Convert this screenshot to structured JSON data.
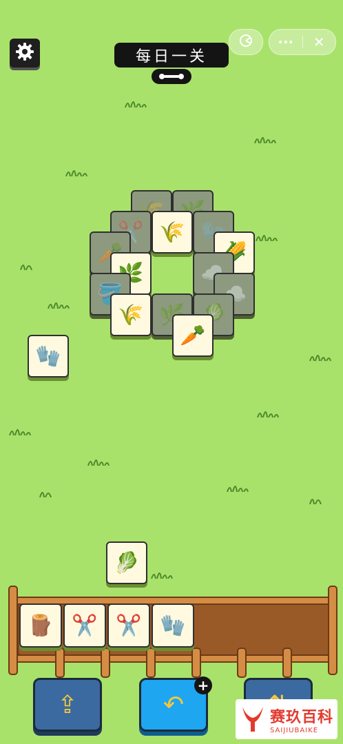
{
  "header": {
    "title": "每日一关",
    "settings_icon": "gear-icon",
    "toggle_icon": "link-toggle-icon"
  },
  "capsule": {
    "game_icon": "game-circle-icon",
    "more_label": "···",
    "close_label": "✕"
  },
  "board": {
    "tiles": [
      {
        "icon": "wheat-bundle",
        "glyph": "🌾",
        "dim": true
      },
      {
        "icon": "grass",
        "glyph": "🌿",
        "dim": true
      },
      {
        "icon": "pruning-shears",
        "glyph": "✂️",
        "dim": true
      },
      {
        "icon": "wheat-bundle",
        "glyph": "🌾",
        "dim": false
      },
      {
        "icon": "blue-glove",
        "glyph": "🧤",
        "dim": true
      },
      {
        "icon": "carrot",
        "glyph": "🥕",
        "dim": true
      },
      {
        "icon": "corn",
        "glyph": "🌽",
        "dim": false
      },
      {
        "icon": "grass",
        "glyph": "🌿",
        "dim": false
      },
      {
        "icon": "bush",
        "glyph": "☁️",
        "dim": true
      },
      {
        "icon": "watering-can",
        "glyph": "🪣",
        "dim": true
      },
      {
        "icon": "bush",
        "glyph": "☁️",
        "dim": true
      },
      {
        "icon": "wheat-bundle",
        "glyph": "🌾",
        "dim": false
      },
      {
        "icon": "grass",
        "glyph": "🌿",
        "dim": true
      },
      {
        "icon": "cabbage",
        "glyph": "🥬",
        "dim": true
      },
      {
        "icon": "carrot",
        "glyph": "🥕",
        "dim": false
      }
    ],
    "loose_tiles": [
      {
        "icon": "blue-glove",
        "glyph": "🧤"
      },
      {
        "icon": "cabbage",
        "glyph": "🥬"
      }
    ]
  },
  "tray": {
    "slots_total": 7,
    "items": [
      {
        "icon": "tree-stump",
        "glyph": "🪵"
      },
      {
        "icon": "pruning-shears",
        "glyph": "✂️"
      },
      {
        "icon": "pruning-shears",
        "glyph": "✂️"
      },
      {
        "icon": "blue-glove",
        "glyph": "🧤"
      }
    ]
  },
  "tools": [
    {
      "name": "remove-tool",
      "icon": "box-out-icon",
      "glyph": "⇪"
    },
    {
      "name": "undo-tool",
      "icon": "undo-arrow-icon",
      "glyph": "↶"
    },
    {
      "name": "shuffle-tool",
      "icon": "shuffle-icon",
      "glyph": "⇅"
    }
  ],
  "plus_label": "+",
  "watermark": {
    "title": "赛玖百科",
    "subtitle": "SAIJIUBAIKE"
  },
  "colors": {
    "background": "#a9e26a",
    "tile_face": "#fff9e0",
    "tile_dim": "#8d9a80",
    "tray_wood": "#9a5a28",
    "button_blue": "#1fa6f0",
    "button_dark_blue": "#3a6aa0"
  }
}
